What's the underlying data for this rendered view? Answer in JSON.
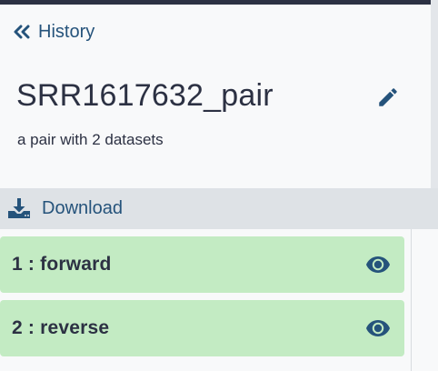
{
  "nav": {
    "back_label": "History",
    "back_icon": "angle-double-left-icon"
  },
  "collection": {
    "name": "SRR1617632_pair",
    "description": "a pair with 2 datasets",
    "edit_icon": "pencil-icon"
  },
  "toolbar": {
    "download_label": "Download",
    "download_icon": "download-icon"
  },
  "datasets": [
    {
      "hid": "1",
      "name": "forward",
      "title": "1 : forward",
      "state_color": "#c3ebc3",
      "action_icon": "eye-icon"
    },
    {
      "hid": "2",
      "name": "reverse",
      "title": "2 : reverse",
      "state_color": "#c3ebc3",
      "action_icon": "eye-icon"
    }
  ],
  "colors": {
    "link": "#25537b",
    "text": "#2c3143",
    "ok_state": "#c3ebc3",
    "toolbar_bg": "#dee2e6"
  }
}
